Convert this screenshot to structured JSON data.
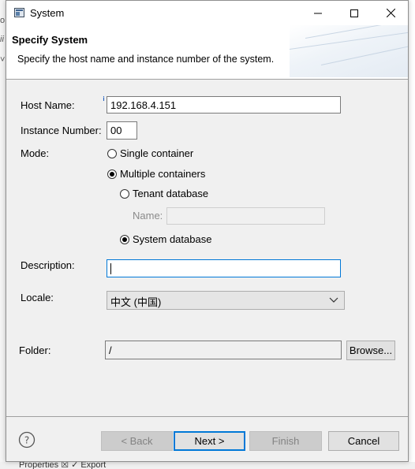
{
  "background": {
    "left_glyphs": [
      "o",
      "ii",
      "˅"
    ],
    "bottom_text": "Properties ☒  ✓ Export"
  },
  "window": {
    "title": "System",
    "icon": "window-app-icon",
    "controls": [
      "minimize-icon",
      "maximize-icon",
      "close-icon"
    ]
  },
  "header": {
    "title": "Specify System",
    "description": "Specify the host name and instance number of the system."
  },
  "form": {
    "host_name_label": "Host Name:",
    "host_name_value": "192.168.4.151",
    "info_icon_glyph": "i",
    "instance_number_label": "Instance Number:",
    "instance_number_value": "00",
    "mode_label": "Mode:",
    "mode_options": {
      "single_container": {
        "label": "Single container",
        "checked": false
      },
      "multiple_containers": {
        "label": "Multiple containers",
        "checked": true
      },
      "tenant_database": {
        "label": "Tenant database",
        "checked": false
      },
      "system_database": {
        "label": "System database",
        "checked": true
      }
    },
    "name_label": "Name:",
    "name_value": "",
    "description_label": "Description:",
    "description_value": "",
    "locale_label": "Locale:",
    "locale_value": "中文 (中国)",
    "folder_label": "Folder:",
    "folder_value": "/",
    "browse_label": "Browse..."
  },
  "footer": {
    "help_icon_glyph": "?",
    "back_label": "< Back",
    "next_label": "Next >",
    "finish_label": "Finish",
    "cancel_label": "Cancel"
  },
  "colors": {
    "dialog_bg": "#f0f0f0",
    "focus_blue": "#0078d7",
    "disabled_text": "#838383"
  }
}
